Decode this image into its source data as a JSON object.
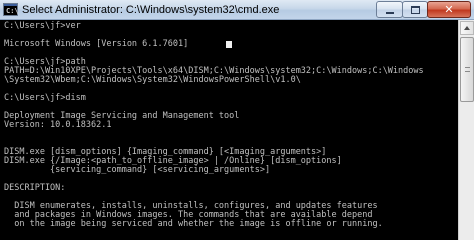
{
  "window": {
    "icon_text": "C:\\",
    "title": "Select Administrator: C:\\Windows\\system32\\cmd.exe",
    "close_glyph": "✕"
  },
  "console": {
    "lines": [
      "C:\\Users\\jf>ver",
      "",
      "Microsoft Windows [Version 6.1.7601]",
      "",
      "C:\\Users\\jf>path",
      "PATH=D:\\Win10XPE\\Projects\\Tools\\x64\\DISM;C:\\Windows\\system32;C:\\Windows;C:\\Windows",
      "\\System32\\Wbem;C:\\Windows\\System32\\WindowsPowerShell\\v1.0\\",
      "",
      "C:\\Users\\jf>dism",
      "",
      "Deployment Image Servicing and Management tool",
      "Version: 10.0.18362.1",
      "",
      "",
      "DISM.exe [dism_options] {Imaging_command} [<Imaging_arguments>]",
      "DISM.exe {/Image:<path_to_offline_image> | /Online} [dism_options]",
      "         {servicing_command} [<servicing_arguments>]",
      "",
      "DESCRIPTION:",
      "",
      "  DISM enumerates, installs, uninstalls, configures, and updates features",
      "  and packages in Windows images. The commands that are available depend",
      "  on the image being serviced and whether the image is offline or running."
    ]
  }
}
